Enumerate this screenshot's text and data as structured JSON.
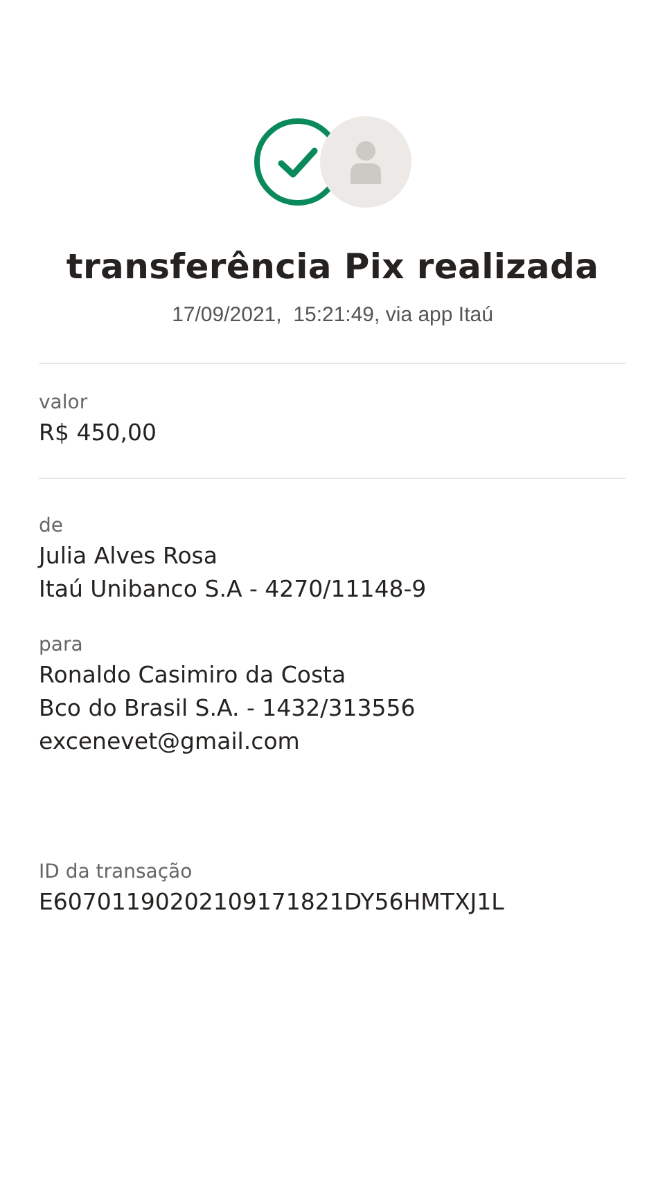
{
  "header": {
    "title": "transferência Pix realizada",
    "subtitle": "17/09/2021,  15:21:49, via app Itaú"
  },
  "groups": [
    {
      "divider": true,
      "fields": [
        {
          "label": "valor",
          "lines": [
            "R$ 450,00"
          ]
        }
      ]
    },
    {
      "divider": false,
      "fields": [
        {
          "label": "de",
          "lines": [
            "Julia Alves Rosa",
            "Itaú Unibanco S.A - 4270/11148-9"
          ]
        },
        {
          "label": "para",
          "lines": [
            "Ronaldo Casimiro da Costa",
            "Bco do Brasil S.A. - 1432/313556",
            "excenevet@gmail.com"
          ]
        }
      ]
    },
    {
      "divider": false,
      "fields": [
        {
          "label": "ID da transação",
          "lines": [
            "E60701190202109171821DY56HMTXJ1L"
          ]
        }
      ]
    }
  ]
}
